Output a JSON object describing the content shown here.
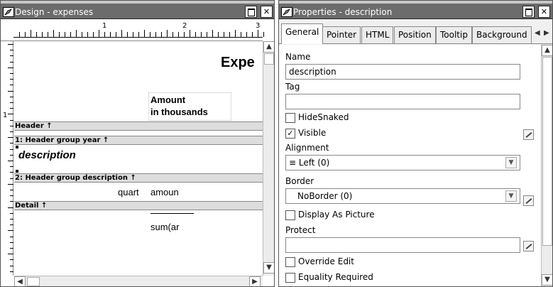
{
  "design_window": {
    "title": "Design - expenses",
    "ruler_numbers": [
      "1",
      "2",
      "3"
    ],
    "vruler_number": "1",
    "report_title": "Expe",
    "amount_label_line1": "Amount",
    "amount_label_line2": "in thousands",
    "bands": {
      "header": "Header ↑",
      "group_year": "1: Header group year ↑",
      "group_description": "2: Header group description ↑",
      "detail": "Detail ↑"
    },
    "fields": {
      "description": "description",
      "quart": "quart",
      "amount": "amoun",
      "sum": "sum(ar"
    }
  },
  "properties_window": {
    "title": "Properties - description",
    "tabs": [
      "General",
      "Pointer",
      "HTML",
      "Position",
      "Tooltip",
      "Background"
    ],
    "active_tab": "General",
    "name": {
      "label": "Name",
      "value": "description"
    },
    "tag": {
      "label": "Tag",
      "value": ""
    },
    "hide_snaked": {
      "label": "HideSnaked",
      "checked": false
    },
    "visible": {
      "label": "Visible",
      "checked": true
    },
    "alignment": {
      "label": "Alignment",
      "value": "≡ Left (0)"
    },
    "border": {
      "label": "Border",
      "value": "NoBorder (0)"
    },
    "display_as_picture": {
      "label": "Display As Picture",
      "checked": false
    },
    "protect": {
      "label": "Protect",
      "value": ""
    },
    "override_edit": {
      "label": "Override Edit",
      "checked": false
    },
    "equality_required": {
      "label": "Equality Required",
      "checked": false
    }
  },
  "icons": {
    "window_icon": "paint-brush-icon",
    "close": "close-icon",
    "maximize": "maximize-icon",
    "scroll_up": "arrow-up-icon",
    "scroll_down": "arrow-down-icon",
    "scroll_left": "arrow-left-icon",
    "scroll_right": "arrow-right-icon",
    "dropdown": "chevron-down-icon",
    "expression_builder": "pencil-icon"
  }
}
